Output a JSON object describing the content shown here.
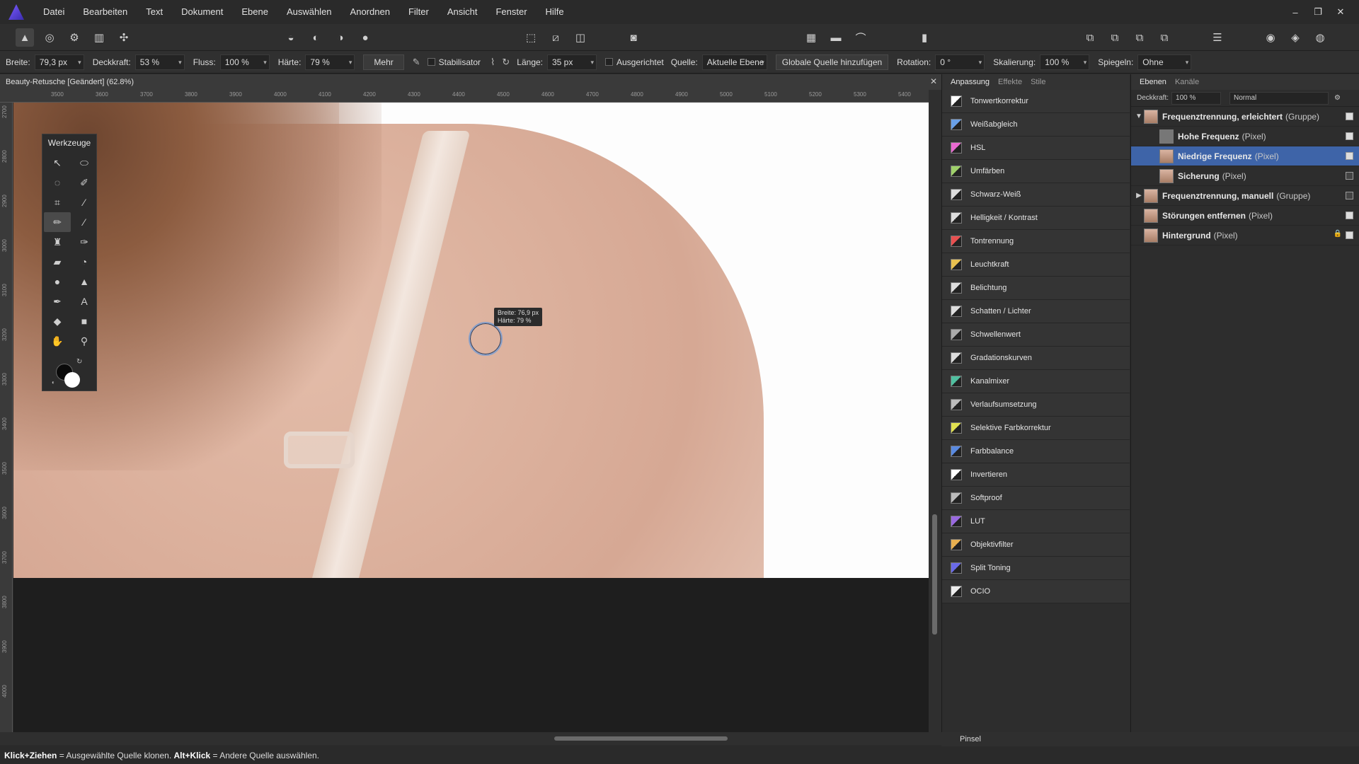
{
  "menu": [
    "Datei",
    "Bearbeiten",
    "Text",
    "Dokument",
    "Ebene",
    "Auswählen",
    "Anordnen",
    "Filter",
    "Ansicht",
    "Fenster",
    "Hilfe"
  ],
  "context": {
    "breite_label": "Breite:",
    "breite": "79,3 px",
    "deckkraft_label": "Deckkraft:",
    "deckkraft": "53 %",
    "fluss_label": "Fluss:",
    "fluss": "100 %",
    "haerte_label": "Härte:",
    "haerte": "79 %",
    "mehr": "Mehr",
    "stabilisator": "Stabilisator",
    "laenge_label": "Länge:",
    "laenge": "35 px",
    "ausgerichtet": "Ausgerichtet",
    "quelle_label": "Quelle:",
    "quelle": "Aktuelle Ebene",
    "globale": "Globale Quelle hinzufügen",
    "rotation_label": "Rotation:",
    "rotation": "0 °",
    "skalierung_label": "Skalierung:",
    "skalierung": "100 %",
    "spiegeln_label": "Spiegeln:",
    "spiegeln": "Ohne"
  },
  "document": {
    "title": "Beauty-Retusche [Geändert] (62.8%)"
  },
  "ruler_h": [
    "3500",
    "3600",
    "3700",
    "3800",
    "3900",
    "4000",
    "4100",
    "4200",
    "4300",
    "4400",
    "4500",
    "4600",
    "4700",
    "4800",
    "4900",
    "5000",
    "5100",
    "5200",
    "5300",
    "5400"
  ],
  "ruler_v": [
    "2700",
    "2800",
    "2900",
    "3000",
    "3100",
    "3200",
    "3300",
    "3400",
    "3500",
    "3600",
    "3700",
    "3800",
    "3900",
    "4000"
  ],
  "tooltip": {
    "line1": "Breite: 76,9 px",
    "line2": "Härte: 79 %"
  },
  "tools": {
    "title": "Werkzeuge"
  },
  "adjust": {
    "tabs": [
      "Anpassung",
      "Effekte",
      "Stile"
    ],
    "items": [
      "Tonwertkorrektur",
      "Weißabgleich",
      "HSL",
      "Umfärben",
      "Schwarz-Weiß",
      "Helligkeit / Kontrast",
      "Tontrennung",
      "Leuchtkraft",
      "Belichtung",
      "Schatten / Lichter",
      "Schwellenwert",
      "Gradationskurven",
      "Kanalmixer",
      "Verlaufsumsetzung",
      "Selektive Farbkorrektur",
      "Farbbalance",
      "Invertieren",
      "Softproof",
      "LUT",
      "Objektivfilter",
      "Split Toning",
      "OCIO"
    ]
  },
  "layers": {
    "tabs": [
      "Ebenen",
      "Kanäle"
    ],
    "opacity_label": "Deckkraft:",
    "opacity": "100 %",
    "blend": "Normal",
    "items": [
      {
        "name": "Frequenztrennung, erleichtert",
        "kind": "(Gruppe)"
      },
      {
        "name": "Hohe Frequenz",
        "kind": "(Pixel)"
      },
      {
        "name": "Niedrige Frequenz",
        "kind": "(Pixel)"
      },
      {
        "name": "Sicherung",
        "kind": "(Pixel)"
      },
      {
        "name": "Frequenztrennung, manuell",
        "kind": "(Gruppe)"
      },
      {
        "name": "Störungen entfernen",
        "kind": "(Pixel)"
      },
      {
        "name": "Hintergrund",
        "kind": "(Pixel)"
      }
    ]
  },
  "bottom": {
    "label": "Pinsel"
  },
  "status": {
    "k1": "Klick+Ziehen",
    "t1": " = Ausgewählte Quelle klonen. ",
    "k2": "Alt+Klick",
    "t2": " = Andere Quelle auswählen."
  }
}
